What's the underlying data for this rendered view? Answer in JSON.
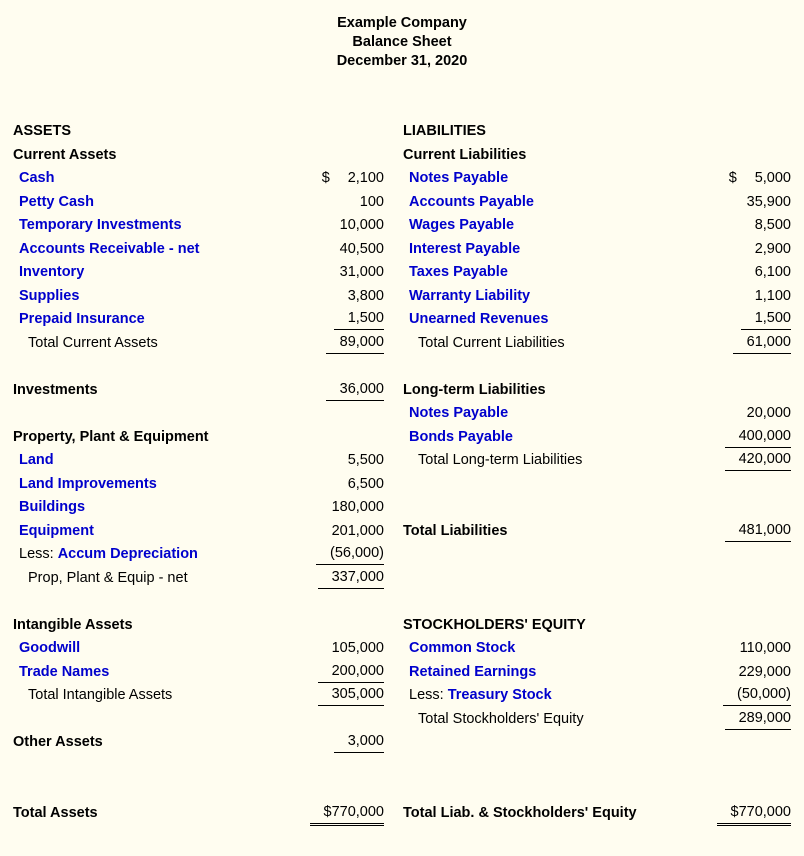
{
  "title": {
    "company": "Example Company",
    "statement": "Balance Sheet",
    "date": "December 31, 2020"
  },
  "assets": {
    "heading": "ASSETS",
    "current": {
      "heading": "Current Assets",
      "items": [
        {
          "label": "Cash",
          "amount": "2,100",
          "currency": "$"
        },
        {
          "label": "Petty Cash",
          "amount": "100"
        },
        {
          "label": "Temporary Investments",
          "amount": "10,000"
        },
        {
          "label": "Accounts Receivable - net",
          "amount": "40,500"
        },
        {
          "label": "Inventory",
          "amount": "31,000"
        },
        {
          "label": "Supplies",
          "amount": "3,800"
        },
        {
          "label": "Prepaid Insurance",
          "amount": "1,500"
        }
      ],
      "total_label": "Total Current Assets",
      "total_amount": "89,000"
    },
    "investments": {
      "label": "Investments",
      "amount": "36,000"
    },
    "ppe": {
      "heading": "Property, Plant & Equipment",
      "items": [
        {
          "label": "Land",
          "amount": "5,500"
        },
        {
          "label": "Land Improvements",
          "amount": "6,500"
        },
        {
          "label": "Buildings",
          "amount": "180,000"
        },
        {
          "label": "Equipment",
          "amount": "201,000"
        }
      ],
      "less_prefix": "Less:",
      "less_label": "Accum Depreciation",
      "less_amount": "(56,000)",
      "total_label": "Prop, Plant & Equip - net",
      "total_amount": "337,000"
    },
    "intangible": {
      "heading": "Intangible Assets",
      "items": [
        {
          "label": "Goodwill",
          "amount": "105,000"
        },
        {
          "label": "Trade Names",
          "amount": "200,000"
        }
      ],
      "total_label": "Total Intangible Assets",
      "total_amount": "305,000"
    },
    "other": {
      "label": "Other Assets",
      "amount": "3,000"
    },
    "grand_total": {
      "label": "Total Assets",
      "amount": "$770,000"
    }
  },
  "liabilities": {
    "heading": "LIABILITIES",
    "current": {
      "heading": "Current Liabilities",
      "items": [
        {
          "label": "Notes Payable",
          "amount": "5,000",
          "currency": "$"
        },
        {
          "label": "Accounts Payable",
          "amount": "35,900"
        },
        {
          "label": "Wages Payable",
          "amount": "8,500"
        },
        {
          "label": "Interest Payable",
          "amount": "2,900"
        },
        {
          "label": "Taxes Payable",
          "amount": "6,100"
        },
        {
          "label": "Warranty Liability",
          "amount": "1,100"
        },
        {
          "label": "Unearned Revenues",
          "amount": "1,500"
        }
      ],
      "total_label": "Total Current Liabilities",
      "total_amount": "61,000"
    },
    "longterm": {
      "heading": "Long-term Liabilities",
      "items": [
        {
          "label": "Notes Payable",
          "amount": "20,000"
        },
        {
          "label": "Bonds Payable",
          "amount": "400,000"
        }
      ],
      "total_label": "Total Long-term Liabilities",
      "total_amount": "420,000"
    },
    "total": {
      "label": "Total Liabilities",
      "amount": "481,000"
    }
  },
  "equity": {
    "heading": "STOCKHOLDERS' EQUITY",
    "items": [
      {
        "label": "Common Stock",
        "amount": "110,000"
      },
      {
        "label": "Retained Earnings",
        "amount": "229,000"
      }
    ],
    "less_prefix": "Less:",
    "less_label": "Treasury Stock",
    "less_amount": "(50,000)",
    "total_label": "Total Stockholders' Equity",
    "total_amount": "289,000",
    "grand_total": {
      "label": "Total Liab. & Stockholders' Equity",
      "amount": "$770,000"
    }
  },
  "colors": {
    "background": "#FFFDF0",
    "link": "#0000CC",
    "text": "#000000"
  }
}
